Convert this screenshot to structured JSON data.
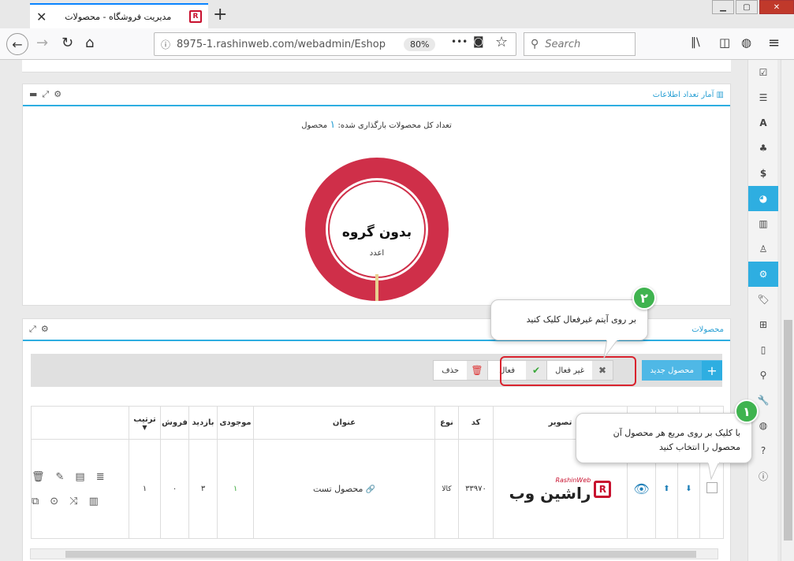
{
  "browser": {
    "tab_title": "مدیریت فروشگاه - محصولات",
    "favicon_text": "R",
    "url": "8975-1.rashinweb.com/webadmin/Eshop",
    "zoom": "80%",
    "search_placeholder": "Search",
    "more_label": "•••"
  },
  "stats_panel": {
    "title": "آمار تعداد اطلاعات",
    "summary_prefix": "تعداد کل محصولات بارگذاری شده:",
    "summary_count": "۱",
    "summary_suffix": "محصول",
    "donut_label": "بدون گروه",
    "donut_sublabel": "اعدد",
    "donut_color": "#cf2f49"
  },
  "products_panel": {
    "title": "محصولات",
    "new_button": "محصول جدید",
    "inactive_button": "غیر فعال",
    "active_button": "فعال",
    "delete_button": "حذف",
    "columns": [
      "تصویر",
      "کد",
      "نوع",
      "عنوان",
      "موجودی",
      "بازدید",
      "فروش",
      "ترتیب"
    ],
    "rows": [
      {
        "code": "۳۳۹۷۰",
        "type": "کالا",
        "title": "محصول تست",
        "stock": "۱",
        "views": "۳",
        "sales": "۰",
        "order": "۱",
        "logo_text": "راشین وب",
        "logo_sub": "RashinWeb"
      }
    ]
  },
  "callouts": {
    "c1_num": "۱",
    "c1_text": "با کلیک بر روی مربع هر محصول آن محصول را انتخاب کنید",
    "c2_num": "۲",
    "c2_text": "بر روی آیتم غیرفعال کلیک کنید"
  }
}
